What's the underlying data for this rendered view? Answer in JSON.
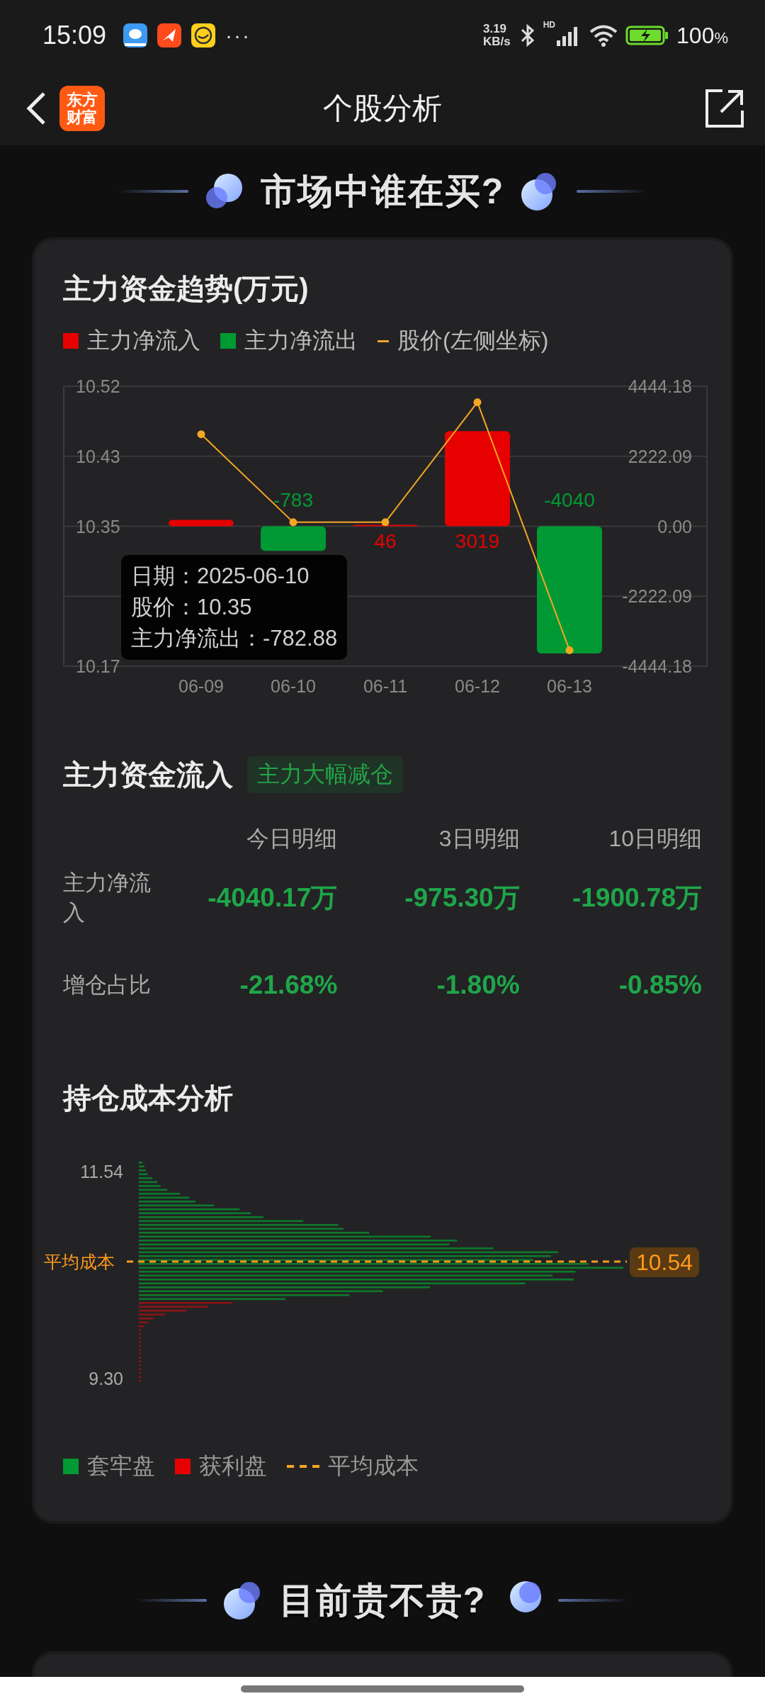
{
  "status_bar": {
    "time": "15:09",
    "more": "···",
    "net_speed": [
      "3.19",
      "KB/s"
    ],
    "network_type": "HD",
    "battery": "100",
    "battery_unit": "%"
  },
  "header": {
    "logo_lines": [
      "东方",
      "财富"
    ],
    "title": "个股分析"
  },
  "headings": [
    "市场中谁在买?",
    "目前贵不贵?"
  ],
  "fund_trend": {
    "title": "主力资金趋势(万元)",
    "chart_data": {
      "type": "bar",
      "categories": [
        "06-09",
        "06-10",
        "06-11",
        "06-12",
        "06-13"
      ],
      "series": [
        {
          "name": "主力净流入",
          "color": "#e60000",
          "values": [
            200,
            null,
            46,
            3019,
            null
          ],
          "value_labels": [
            null,
            null,
            "46",
            "3019",
            null
          ]
        },
        {
          "name": "主力净流出",
          "color": "#009933",
          "values": [
            null,
            -783,
            null,
            null,
            -4040
          ],
          "value_labels": [
            null,
            "-783",
            null,
            null,
            "-4040"
          ]
        }
      ],
      "grid": true,
      "ylim": [
        -4444.18,
        4444.18
      ],
      "yticks": [
        {
          "value": -4444.18,
          "label": "-4444.18"
        },
        {
          "value": -2222.09,
          "label": "-2222.09"
        },
        {
          "value": 0,
          "label": "0.00"
        },
        {
          "value": 2222.09,
          "label": "2222.09"
        },
        {
          "value": 4444.18,
          "label": "4444.18"
        }
      ]
    },
    "price_overlay": {
      "chart_data": {
        "type": "line",
        "series": [
          {
            "name": "股价(左侧坐标)",
            "color": "#f5a623",
            "marker": "o",
            "values": [
              10.46,
              10.35,
              10.35,
              10.5,
              10.19
            ]
          }
        ],
        "ylim": [
          10.17,
          10.52
        ],
        "yticks": [
          {
            "value": 10.17,
            "label": "10.17"
          },
          {
            "value": 10.345,
            "label": "10.35"
          },
          {
            "value": 10.4325,
            "label": "10.43"
          },
          {
            "value": 10.52,
            "label": "10.52"
          }
        ]
      }
    },
    "tooltip": [
      "日期：2025-06-10",
      "股价：10.35",
      "主力净流出：-782.88"
    ]
  },
  "fund_inflow": {
    "title": "主力资金流入",
    "badge": "主力大幅减仓",
    "columns": [
      "今日明细",
      "3日明细",
      "10日明细"
    ],
    "rows": [
      {
        "label": "主力净流入",
        "cells": [
          "-4040.17万",
          "-975.30万",
          "-1900.78万"
        ]
      },
      {
        "label": "增仓占比",
        "cells": [
          "-21.68%",
          "-1.80%",
          "-0.85%"
        ]
      }
    ]
  },
  "cost_analysis": {
    "title": "持仓成本分析",
    "price_high": "11.54",
    "price_low": "9.30",
    "avg_label": "平均成本",
    "avg_value": "10.54",
    "legend": [
      {
        "label": "套牢盘",
        "color": "#009933",
        "kind": "square"
      },
      {
        "label": "获利盘",
        "color": "#e60000",
        "kind": "square"
      },
      {
        "label": "平均成本",
        "color": "#f5a623",
        "kind": "dash"
      }
    ]
  }
}
